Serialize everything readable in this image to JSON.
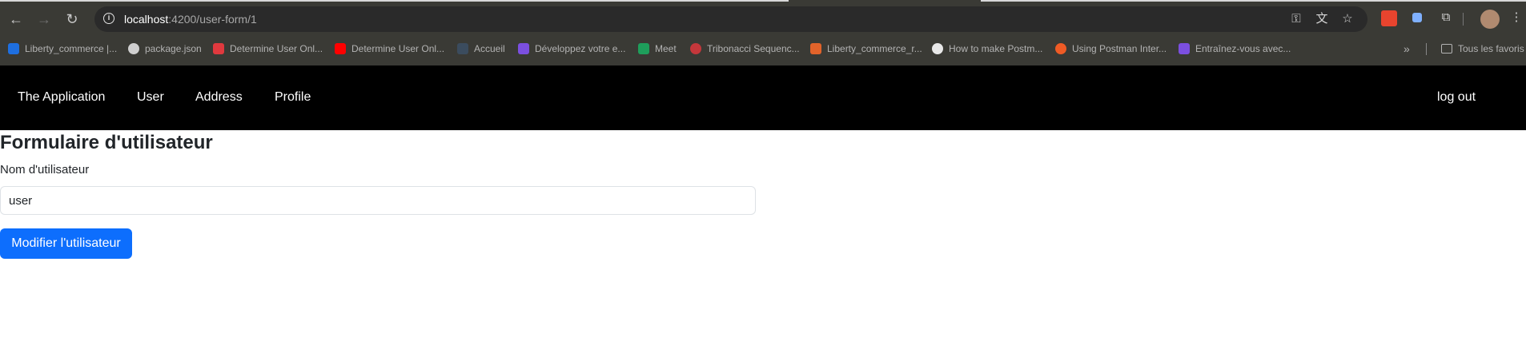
{
  "browser": {
    "url_host": "localhost",
    "url_path": ":4200/user-form/1",
    "bookmarks": [
      {
        "label": "Liberty_commerce |...",
        "color": "#1e6fe0"
      },
      {
        "label": "package.json",
        "color": "#cfcfcf"
      },
      {
        "label": "Determine User Onl...",
        "color": "#e0393e"
      },
      {
        "label": "Determine User Onl...",
        "color": "#ff0000"
      },
      {
        "label": "Accueil",
        "color": "#3b4c5e"
      },
      {
        "label": "Développez votre e...",
        "color": "#7b4fe0"
      },
      {
        "label": "Meet",
        "color": "#1e9e5b"
      },
      {
        "label": "Tribonacci Sequenc...",
        "color": "#c4373b"
      },
      {
        "label": "Liberty_commerce_r...",
        "color": "#e2632a"
      },
      {
        "label": "How to make Postm...",
        "color": "#e8e8e8"
      },
      {
        "label": "Using Postman Inter...",
        "color": "#ef5b25"
      },
      {
        "label": "Entraînez-vous avec...",
        "color": "#7b4fe0"
      }
    ],
    "bookmarks_more": "»",
    "all_bookmarks": "Tous les favoris"
  },
  "nav": {
    "brand": "The Application",
    "items": [
      "User",
      "Address",
      "Profile"
    ],
    "logout": "log out"
  },
  "form": {
    "title": "Formulaire d'utilisateur",
    "username_label": "Nom d'utilisateur",
    "username_value": "user",
    "submit_label": "Modifier l'utilisateur"
  },
  "colors": {
    "primary": "#0d6efd",
    "navbar_bg": "#000000",
    "chrome_bg": "#3a3a35"
  }
}
